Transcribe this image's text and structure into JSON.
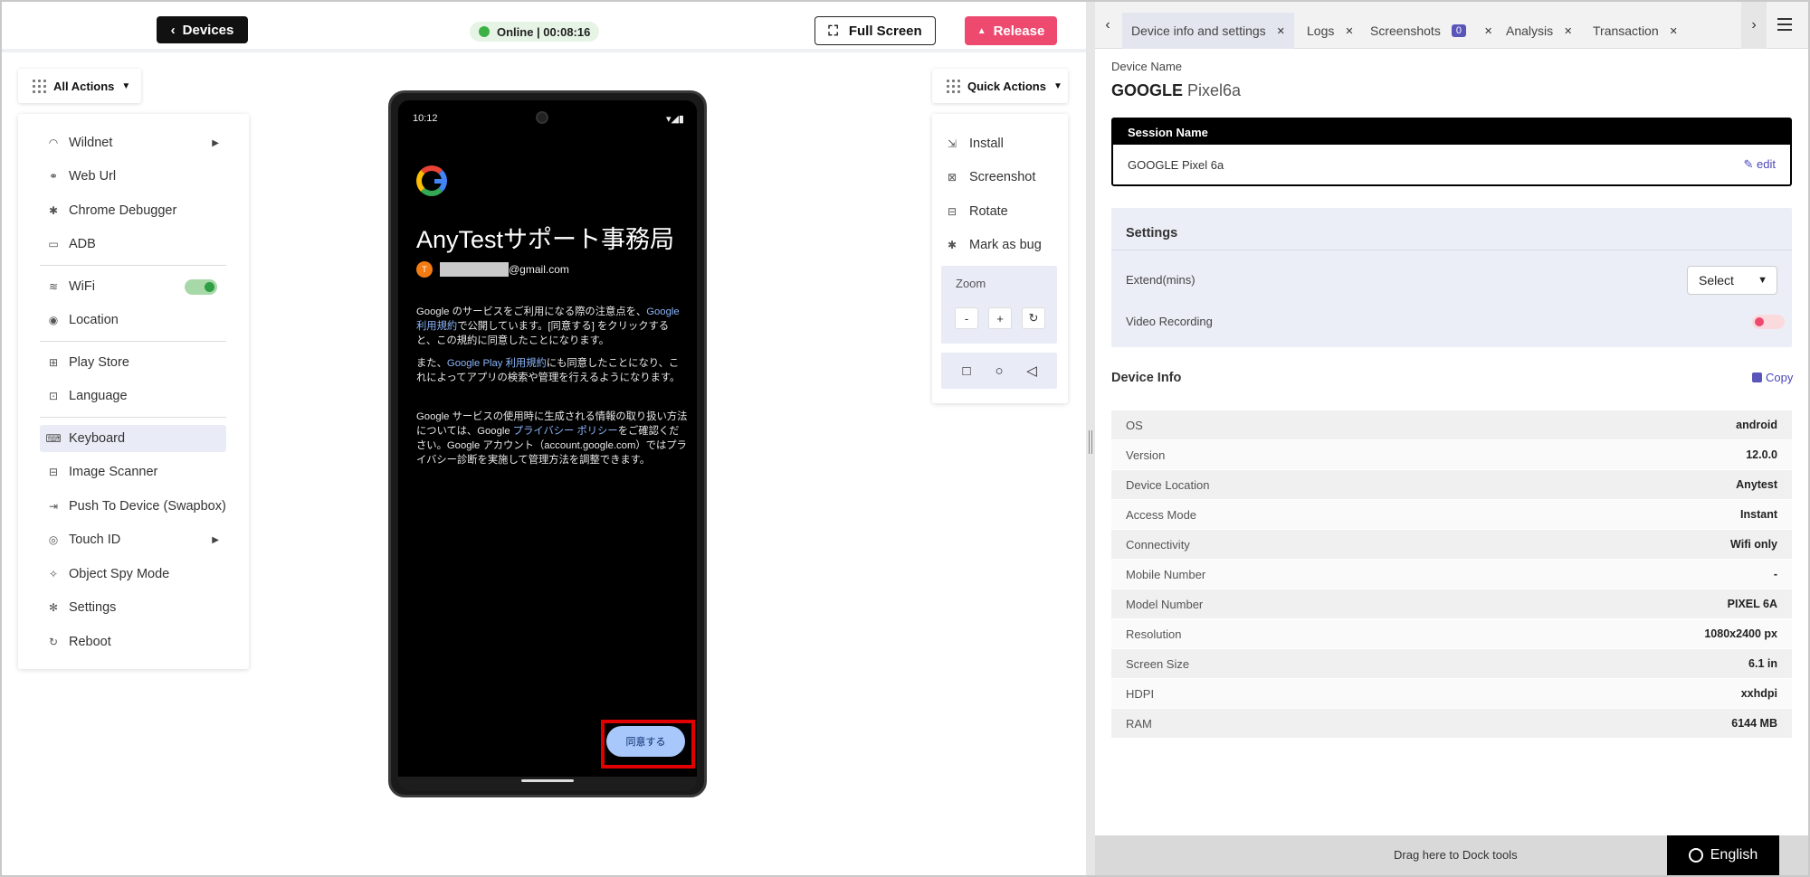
{
  "topbar": {
    "devices_label": "Devices",
    "status": "Online | 00:08:16",
    "fullscreen_label": "Full Screen",
    "release_label": "Release"
  },
  "left_menu": {
    "title": "All Actions",
    "items": [
      {
        "label": "Wildnet",
        "icon": "wifi-signal-icon"
      },
      {
        "label": "Web Url",
        "icon": "link-icon"
      },
      {
        "label": "Chrome Debugger",
        "icon": "bug-icon"
      },
      {
        "label": "ADB",
        "icon": "terminal-icon"
      },
      {
        "label": "WiFi",
        "icon": "wifi-icon"
      },
      {
        "label": "Location",
        "icon": "location-pin-icon"
      },
      {
        "label": "Play Store",
        "icon": "apps-icon"
      },
      {
        "label": "Language",
        "icon": "translate-icon"
      },
      {
        "label": "Keyboard",
        "icon": "keyboard-icon"
      },
      {
        "label": "Image Scanner",
        "icon": "image-scan-icon"
      },
      {
        "label": "Push To Device (Swapbox)",
        "icon": "push-icon"
      },
      {
        "label": "Touch ID",
        "icon": "fingerprint-icon"
      },
      {
        "label": "Object Spy Mode",
        "icon": "spy-icon"
      },
      {
        "label": "Settings",
        "icon": "gear-icon"
      },
      {
        "label": "Reboot",
        "icon": "reload-icon"
      }
    ]
  },
  "phone": {
    "time": "10:12",
    "app_title": "AnyTestサポート事務局",
    "avatar_letter": "T",
    "email_suffix": "@gmail.com",
    "p1_a": "Google のサービスをご利用になる際の注意点を、",
    "p1_link": "Google 利用規約",
    "p1_b": "で公開しています。[同意する] をクリックすると、この規約に同意したことになります。",
    "p2_a": "また、",
    "p2_link": "Google Play 利用規約",
    "p2_b": "にも同意したことになり、これによってアプリの検索や管理を行えるようになります。",
    "p3_a": "Google サービスの使用時に生成される情報の取り扱い方法については、Google ",
    "p3_link": "プライバシー ポリシー",
    "p3_b": "をご確認ください。Google アカウント（account.google.com）ではプライバシー診断を実施して管理方法を調整できます。",
    "agree_label": "同意する"
  },
  "quick_actions": {
    "title": "Quick Actions",
    "items": [
      {
        "label": "Install"
      },
      {
        "label": "Screenshot"
      },
      {
        "label": "Rotate"
      },
      {
        "label": "Mark as bug"
      }
    ],
    "zoom_label": "Zoom",
    "zoom_out": "-",
    "zoom_in": "+"
  },
  "tabs": [
    {
      "label": "Device info and settings"
    },
    {
      "label": "Logs"
    },
    {
      "label": "Screenshots",
      "badge": "0"
    },
    {
      "label": "Analysis"
    },
    {
      "label": "Transaction"
    }
  ],
  "device": {
    "name_label": "Device Name",
    "brand": "GOOGLE",
    "model": "Pixel6a",
    "session_header": "Session Name",
    "session_value": "GOOGLE Pixel 6a",
    "edit_label": "edit"
  },
  "settings": {
    "title": "Settings",
    "extend_label": "Extend(mins)",
    "select_value": "Select",
    "video_label": "Video Recording"
  },
  "device_info": {
    "title": "Device Info",
    "copy_label": "Copy",
    "rows": [
      {
        "k": "OS",
        "v": "android"
      },
      {
        "k": "Version",
        "v": "12.0.0"
      },
      {
        "k": "Device Location",
        "v": "Anytest"
      },
      {
        "k": "Access Mode",
        "v": "Instant"
      },
      {
        "k": "Connectivity",
        "v": "Wifi only"
      },
      {
        "k": "Mobile Number",
        "v": "-"
      },
      {
        "k": "Model Number",
        "v": "PIXEL 6A"
      },
      {
        "k": "Resolution",
        "v": "1080x2400 px"
      },
      {
        "k": "Screen Size",
        "v": "6.1 in"
      },
      {
        "k": "HDPI",
        "v": "xxhdpi"
      },
      {
        "k": "RAM",
        "v": "6144 MB"
      }
    ]
  },
  "footer": {
    "dock_text": "Drag here to Dock tools",
    "language": "English"
  }
}
